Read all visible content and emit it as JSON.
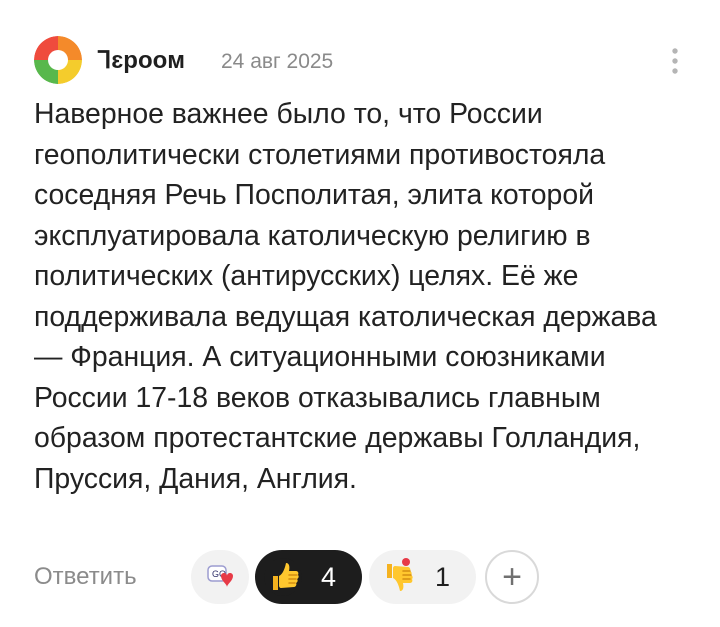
{
  "comment": {
    "author": "Ꞁɛpooм",
    "date": "24 авг 2025",
    "text": "Наверное важнее было то, что России геополитически столетиями противостояла соседняя Речь Посполитая, элита которой эксплуатировала католическую религию в политических (антирусских) целях. Её же поддерживала ведущая католическая держава — Франция. А ситуационными союзниками России 17-18 веков отказывались главным образом протестантские державы Голландия, Пруссия, Дания, Англия."
  },
  "actions": {
    "reply_label": "Ответить",
    "reactions": [
      {
        "icon": "heart-sticker-icon",
        "count": null
      },
      {
        "icon": "thumbs-up-icon",
        "count": "4",
        "active": true
      },
      {
        "icon": "thumbs-down-icon",
        "count": "1",
        "active": false
      }
    ],
    "add_reaction_label": "+"
  },
  "colors": {
    "text": "#222222",
    "muted": "#8a8a8a",
    "active_pill": "#1d1d1d",
    "inactive_pill": "#f2f2f2",
    "avatar_green": "#58b84c",
    "avatar_orange": "#f48a2a",
    "avatar_yellow": "#f4cc2c",
    "avatar_red": "#ef4b3d"
  }
}
